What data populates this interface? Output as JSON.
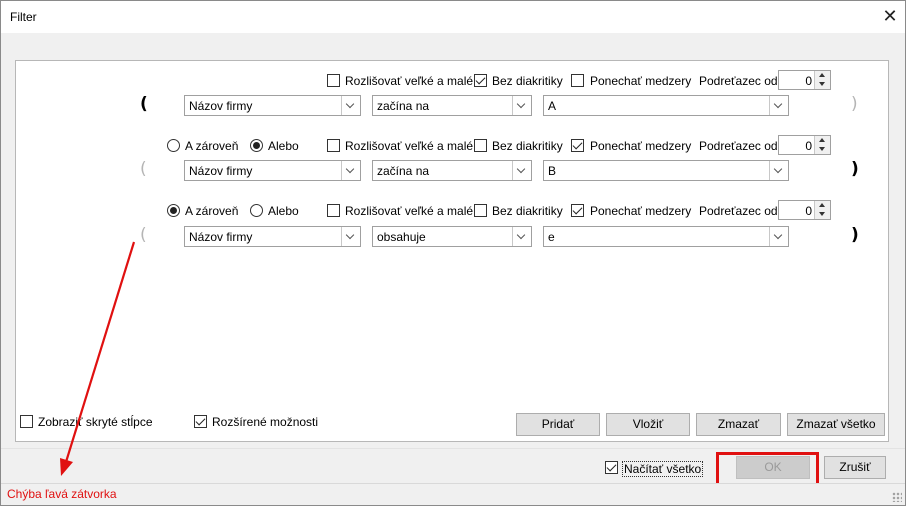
{
  "window": {
    "title": "Filter"
  },
  "rows": [
    {
      "logic": null,
      "case_sensitive": {
        "label": "Rozlišovať veľké a malé",
        "checked": false
      },
      "no_diacritics": {
        "label": "Bez diakritiky",
        "checked": true
      },
      "keep_spaces": {
        "label": "Ponechať medzery",
        "checked": false
      },
      "substring_label": "Podreťazec od",
      "substring_value": "0",
      "open_paren": "(",
      "open_paren_active": true,
      "field": "Názov firmy",
      "operator": "začína na",
      "value": "A",
      "close_paren": ")",
      "close_paren_active": false
    },
    {
      "logic": {
        "and_label": "A zároveň",
        "or_label": "Alebo",
        "selected": "or"
      },
      "case_sensitive": {
        "label": "Rozlišovať veľké a malé",
        "checked": false
      },
      "no_diacritics": {
        "label": "Bez diakritiky",
        "checked": false
      },
      "keep_spaces": {
        "label": "Ponechať medzery",
        "checked": true
      },
      "substring_label": "Podreťazec od",
      "substring_value": "0",
      "open_paren": "(",
      "open_paren_active": false,
      "field": "Názov firmy",
      "operator": "začína na",
      "value": "B",
      "close_paren": ")",
      "close_paren_active": true
    },
    {
      "logic": {
        "and_label": "A zároveň",
        "or_label": "Alebo",
        "selected": "and"
      },
      "case_sensitive": {
        "label": "Rozlišovať veľké a malé",
        "checked": false
      },
      "no_diacritics": {
        "label": "Bez diakritiky",
        "checked": false
      },
      "keep_spaces": {
        "label": "Ponechať medzery",
        "checked": true
      },
      "substring_label": "Podreťazec od",
      "substring_value": "0",
      "open_paren": "(",
      "open_paren_active": false,
      "field": "Názov firmy",
      "operator": "obsahuje",
      "value": "e",
      "close_paren": ")",
      "close_paren_active": true
    }
  ],
  "options": {
    "show_hidden_columns": {
      "label": "Zobraziť skryté stĺpce",
      "checked": false
    },
    "advanced": {
      "label": "Rozšírené možnosti",
      "checked": true
    }
  },
  "actions": {
    "add": "Pridať",
    "insert": "Vložiť",
    "delete": "Zmazať",
    "delete_all": "Zmazať všetko"
  },
  "footer": {
    "load_all": {
      "label": "Načítať všetko",
      "checked": true
    },
    "ok": "OK",
    "cancel": "Zrušiť"
  },
  "status": {
    "error": "Chýba ľavá zátvorka"
  },
  "colors": {
    "error": "#e01010",
    "highlight": "#e01010"
  }
}
